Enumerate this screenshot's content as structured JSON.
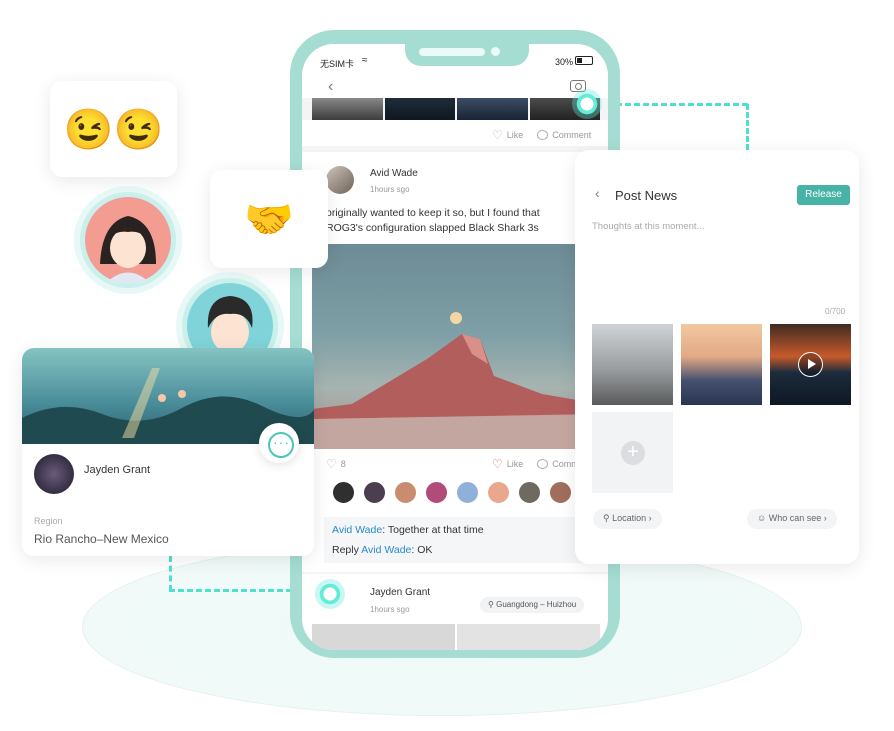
{
  "status_bar": {
    "carrier": "无SIM卡",
    "wifi_icon": "wifi-icon",
    "battery": "30%"
  },
  "feed": {
    "top_post": {
      "like_label": "Like",
      "comment_label": "Comment"
    },
    "post": {
      "author": "Avid Wade",
      "time": "1hours sgo",
      "text_line1": "originally wanted to keep it so, but I found that",
      "text_line2": "ROG3's configuration slapped Black Shark 3s",
      "like_count": "8",
      "like_label": "Like",
      "comment_label": "Comm",
      "comments": [
        {
          "user": "Avid Wade",
          "text": ": Together at that time"
        },
        {
          "prefix": "Reply ",
          "user": "Avid Wade",
          "text": ": OK"
        }
      ]
    },
    "next_post": {
      "author": "Jayden Grant",
      "time": "1hours sgo",
      "location": "Guangdong – Huizhou"
    }
  },
  "profile_card": {
    "name": "Jayden Grant",
    "region_label": "Region",
    "region_value": "Rio Rancho–New Mexico"
  },
  "post_news": {
    "title": "Post News",
    "release_label": "Release",
    "placeholder": "Thoughts at this moment...",
    "counter": "0/700",
    "location_label": "Location",
    "visibility_label": "Who can see"
  },
  "stickers": {
    "wink": "😉",
    "handshake": "🤝"
  },
  "colors": {
    "accent": "#46b3a6",
    "phone_frame": "#a5ddd3",
    "connector": "#4ee0cf",
    "link": "#2b89c9"
  }
}
